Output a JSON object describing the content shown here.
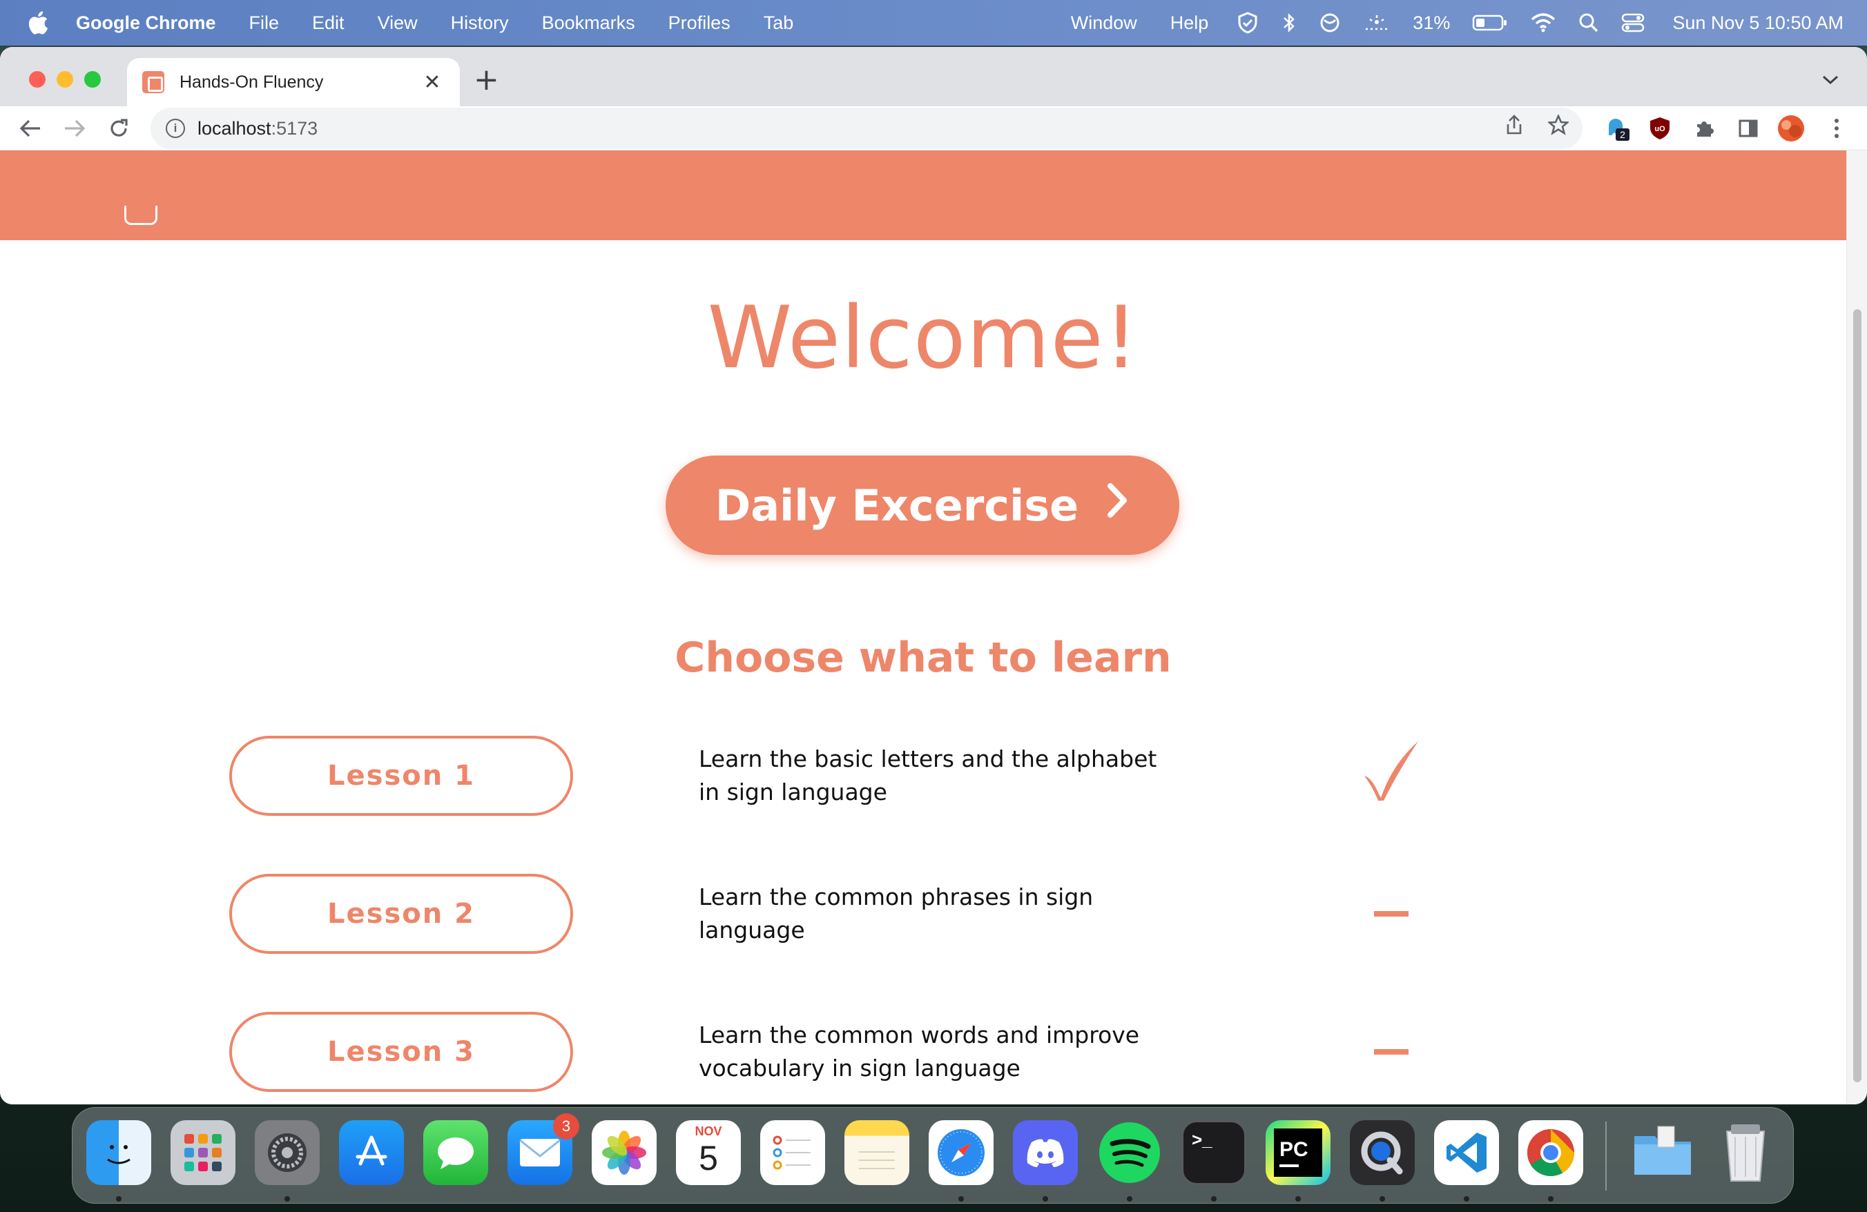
{
  "menubar": {
    "app_name": "Google Chrome",
    "items": [
      "File",
      "Edit",
      "View",
      "History",
      "Bookmarks",
      "Profiles",
      "Tab",
      "Window",
      "Help"
    ],
    "battery": "31%",
    "datetime": "Sun Nov 5  10:50 AM"
  },
  "browser": {
    "tab_title": "Hands-On Fluency",
    "url_host": "localhost",
    "url_port": ":5173",
    "extension_badge": "2"
  },
  "page": {
    "welcome": "Welcome!",
    "daily_button": "Daily Excercise",
    "choose_heading": "Choose what to learn",
    "lessons": [
      {
        "label": "Lesson 1",
        "description": "Learn the basic letters and the alphabet in sign language",
        "status": "completed"
      },
      {
        "label": "Lesson 2",
        "description": "Learn the common phrases in sign language",
        "status": "not-started"
      },
      {
        "label": "Lesson 3",
        "description": "Learn the common words and improve vocabulary in sign language",
        "status": "not-started"
      }
    ]
  },
  "dock": {
    "items": [
      "finder",
      "launchpad",
      "system-settings",
      "app-store",
      "messages",
      "mail",
      "photos",
      "calendar",
      "reminders",
      "notes",
      "safari",
      "discord",
      "spotify",
      "terminal",
      "pycharm",
      "quicktime",
      "vscode",
      "chrome",
      "downloads-folder",
      "trash"
    ],
    "mail_badge": "3",
    "calendar_month": "NOV",
    "calendar_day": "5",
    "pycharm_label": "PC"
  },
  "colors": {
    "accent": "#ee8669",
    "menubar": "#6a8cc9"
  }
}
